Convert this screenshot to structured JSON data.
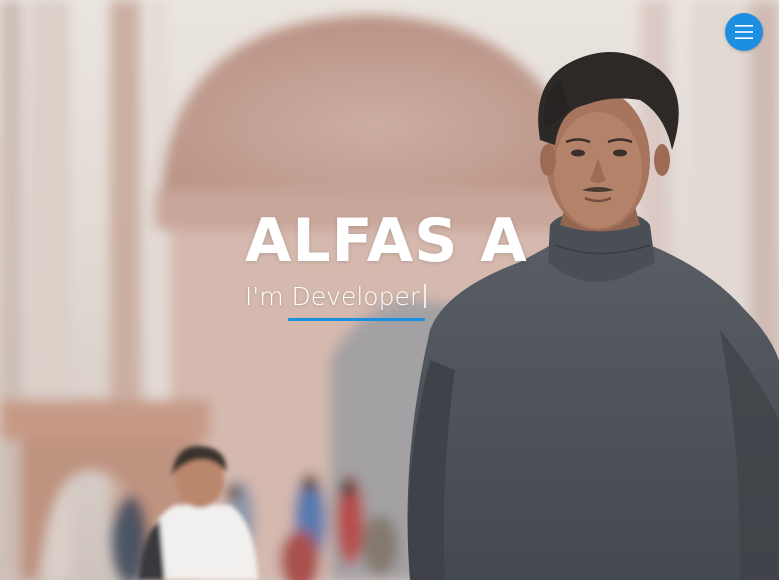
{
  "hero": {
    "name": "ALFAS A",
    "subtitle": "I'm Developer"
  },
  "menu": {
    "icon": "hamburger-menu-icon"
  },
  "colors": {
    "accent": "#1c8fe0",
    "text": "#ffffff"
  }
}
